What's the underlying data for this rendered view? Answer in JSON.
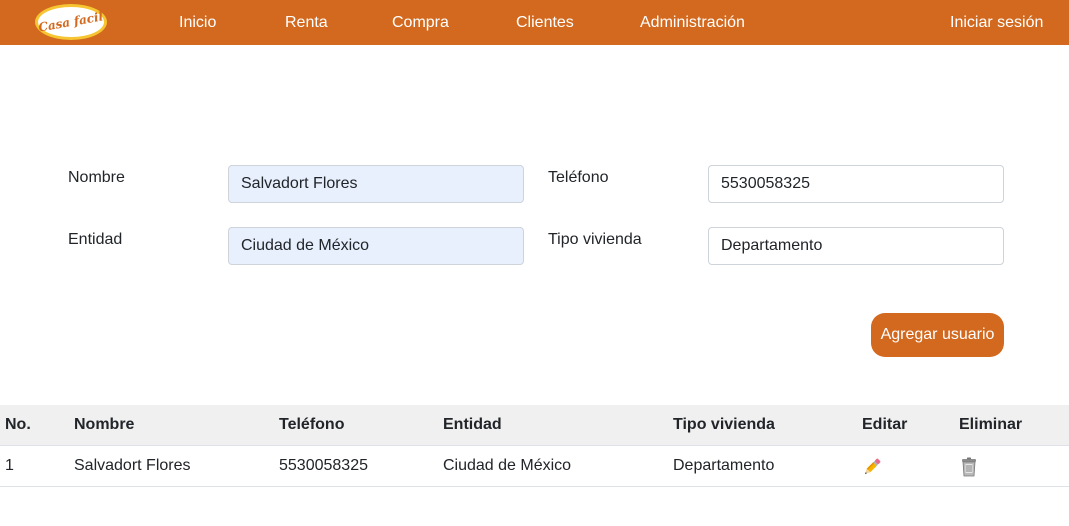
{
  "navbar": {
    "logo_text": "Casa facil",
    "links": [
      "Inicio",
      "Renta",
      "Compra",
      "Clientes",
      "Administración"
    ],
    "login": "Iniciar sesión",
    "color": "#d2691e"
  },
  "form": {
    "nombre_label": "Nombre",
    "nombre_value": "Salvadort Flores",
    "telefono_label": "Teléfono",
    "telefono_value": "5530058325",
    "entidad_label": "Entidad",
    "entidad_value": "Ciudad de México",
    "tipo_label": "Tipo vivienda",
    "tipo_value": "Departamento",
    "submit_label": "Agregar usuario"
  },
  "table": {
    "headers": [
      "No.",
      "Nombre",
      "Teléfono",
      "Entidad",
      "Tipo vivienda",
      "Editar",
      "Eliminar"
    ],
    "rows": [
      {
        "no": "1",
        "nombre": "Salvadort Flores",
        "telefono": "5530058325",
        "entidad": "Ciudad de México",
        "tipo": "Departamento",
        "edit_icon": "pencil-icon",
        "delete_icon": "trash-icon"
      }
    ]
  }
}
